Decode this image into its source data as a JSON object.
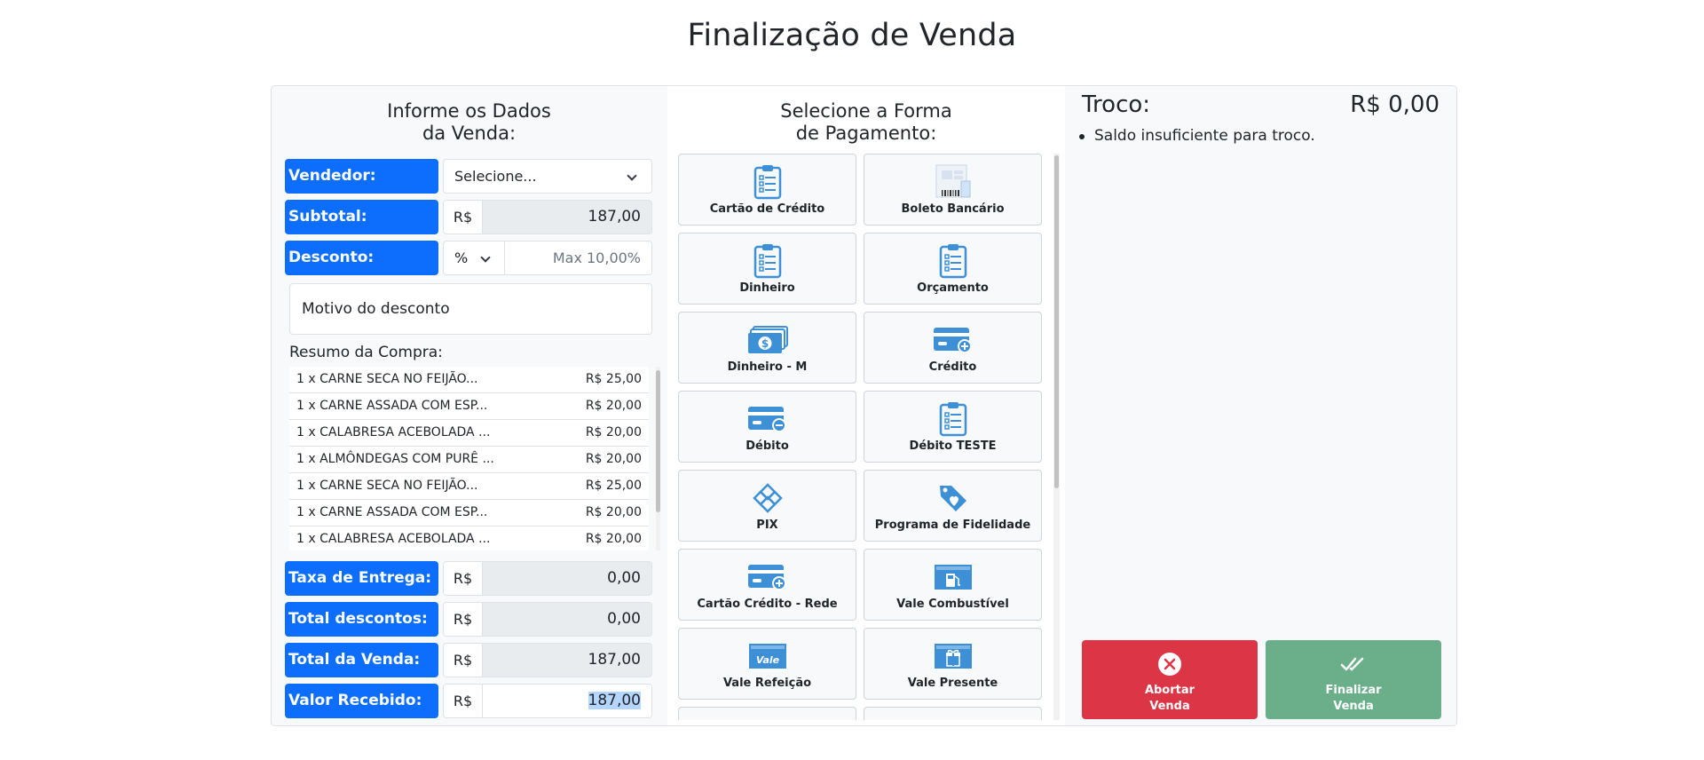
{
  "page": {
    "title": "Finalização de Venda"
  },
  "left": {
    "title_line1": "Informe os Dados",
    "title_line2": "da Venda:",
    "vendedor": {
      "label": "Vendedor:",
      "value": "Selecione..."
    },
    "subtotal": {
      "label": "Subtotal:",
      "prefix": "R$",
      "value": "187,00"
    },
    "desconto": {
      "label": "Desconto:",
      "type": "%",
      "placeholder": "Max 10,00%"
    },
    "motivo_placeholder": "Motivo do desconto",
    "resumo_label": "Resumo da Compra:",
    "resumo_items": [
      {
        "name": "1 x CARNE SECA NO FEIJÃO...",
        "price": "R$ 25,00"
      },
      {
        "name": "1 x CARNE ASSADA COM ESP...",
        "price": "R$ 20,00"
      },
      {
        "name": "1 x CALABRESA ACEBOLADA ...",
        "price": "R$ 20,00"
      },
      {
        "name": "1 x ALMÔNDEGAS COM PURÊ ...",
        "price": "R$ 20,00"
      },
      {
        "name": "1 x CARNE SECA NO FEIJÃO...",
        "price": "R$ 25,00"
      },
      {
        "name": "1 x CARNE ASSADA COM ESP...",
        "price": "R$ 20,00"
      },
      {
        "name": "1 x CALABRESA ACEBOLADA ...",
        "price": "R$ 20,00"
      }
    ],
    "taxa_entrega": {
      "label": "Taxa de Entrega:",
      "prefix": "R$",
      "value": "0,00"
    },
    "total_descontos": {
      "label": "Total descontos:",
      "prefix": "R$",
      "value": "0,00"
    },
    "total_venda": {
      "label": "Total da Venda:",
      "prefix": "R$",
      "value": "187,00"
    },
    "valor_recebido": {
      "label": "Valor Recebido:",
      "prefix": "R$",
      "value": "187,00"
    }
  },
  "middle": {
    "title_line1": "Selecione a Forma",
    "title_line2": "de Pagamento:",
    "methods": [
      {
        "name": "Cartão de Crédito",
        "icon": "clipboard-icon"
      },
      {
        "name": "Boleto Bancário",
        "icon": "barcode-document-icon"
      },
      {
        "name": "Dinheiro",
        "icon": "clipboard-icon"
      },
      {
        "name": "Orçamento",
        "icon": "clipboard-icon"
      },
      {
        "name": "Dinheiro - M",
        "icon": "cash-stack-icon"
      },
      {
        "name": "Crédito",
        "icon": "card-plus-icon"
      },
      {
        "name": "Débito",
        "icon": "card-minus-icon"
      },
      {
        "name": "Débito TESTE",
        "icon": "clipboard-icon"
      },
      {
        "name": "PIX",
        "icon": "pix-icon"
      },
      {
        "name": "Programa de Fidelidade",
        "icon": "heart-tag-icon"
      },
      {
        "name": "Cartão Crédito - Rede",
        "icon": "card-plus-icon"
      },
      {
        "name": "Vale Combustível",
        "icon": "fuel-voucher-icon"
      },
      {
        "name": "Vale Refeição",
        "icon": "meal-voucher-icon",
        "icon_text": "Vale"
      },
      {
        "name": "Vale Presente",
        "icon": "gift-voucher-icon"
      }
    ]
  },
  "right": {
    "troco_label": "Troco:",
    "troco_value": "R$ 0,00",
    "message": "Saldo insuficiente para troco.",
    "abort_line1": "Abortar",
    "abort_line2": "Venda",
    "final_line1": "Finalizar",
    "final_line2": "Venda"
  },
  "colors": {
    "primary": "#0d6efd",
    "danger": "#dc3545",
    "success": "#6aaf8a",
    "icon": "#3d8fd6"
  }
}
